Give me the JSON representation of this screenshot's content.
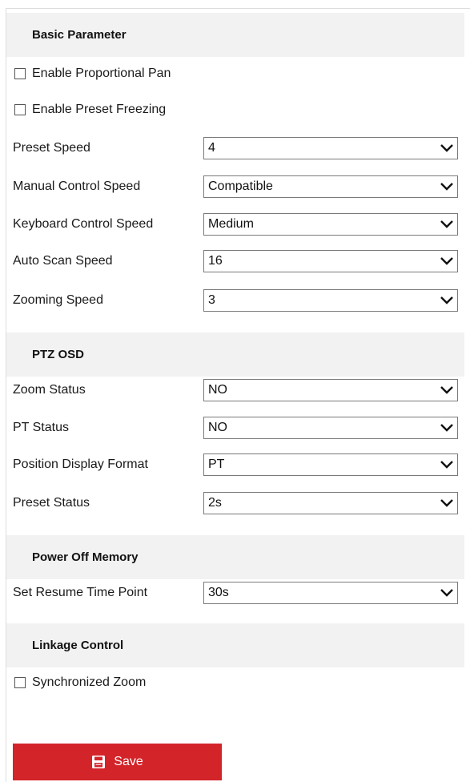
{
  "sections": {
    "basic": {
      "title": "Basic Parameter"
    },
    "osd": {
      "title": "PTZ OSD"
    },
    "power": {
      "title": "Power Off Memory"
    },
    "linkage": {
      "title": "Linkage Control"
    }
  },
  "checkboxes": {
    "proportional_pan": {
      "label": "Enable Proportional Pan",
      "checked": false
    },
    "preset_freezing": {
      "label": "Enable Preset Freezing",
      "checked": false
    },
    "synchronized_zoom": {
      "label": "Synchronized Zoom",
      "checked": false
    }
  },
  "fields": {
    "preset_speed": {
      "label": "Preset Speed",
      "value": "4"
    },
    "manual_control_speed": {
      "label": "Manual Control Speed",
      "value": "Compatible"
    },
    "keyboard_control_speed": {
      "label": "Keyboard Control Speed",
      "value": "Medium"
    },
    "auto_scan_speed": {
      "label": "Auto Scan Speed",
      "value": "16"
    },
    "zooming_speed": {
      "label": "Zooming Speed",
      "value": "3"
    },
    "zoom_status": {
      "label": "Zoom Status",
      "value": "NO"
    },
    "pt_status": {
      "label": "PT Status",
      "value": "NO"
    },
    "position_display_format": {
      "label": "Position Display Format",
      "value": "PT"
    },
    "preset_status": {
      "label": "Preset Status",
      "value": "2s"
    },
    "resume_time_point": {
      "label": "Set Resume Time Point",
      "value": "30s"
    }
  },
  "save_button": {
    "label": "Save",
    "color": "#d3242a",
    "icon": "save-icon"
  },
  "colors": {
    "section_bg": "#f2f2f2",
    "accent": "#d3242a"
  }
}
